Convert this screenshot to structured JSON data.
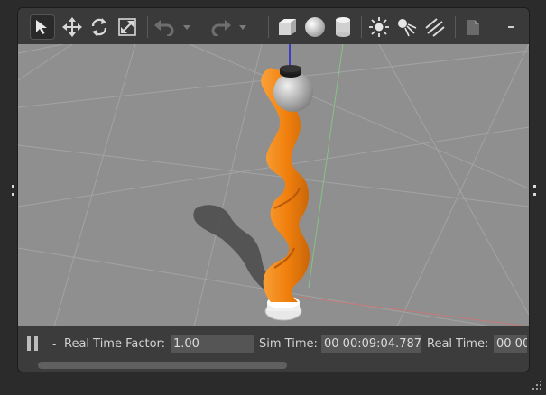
{
  "toolbar": {
    "tools": [
      {
        "name": "select-mode",
        "icon": "arrow-cursor-icon",
        "active": true
      },
      {
        "name": "translate-mode",
        "icon": "move-arrows-icon"
      },
      {
        "name": "rotate-mode",
        "icon": "rotate-icon"
      },
      {
        "name": "scale-mode",
        "icon": "scale-icon"
      },
      {
        "name": "undo",
        "icon": "undo-icon"
      },
      {
        "name": "undo-history",
        "icon": "chevron-down-icon"
      },
      {
        "name": "redo",
        "icon": "redo-icon"
      },
      {
        "name": "redo-history",
        "icon": "chevron-down-icon"
      },
      {
        "name": "insert-box",
        "icon": "box-icon"
      },
      {
        "name": "insert-sphere",
        "icon": "sphere-icon"
      },
      {
        "name": "insert-cylinder",
        "icon": "cylinder-icon"
      },
      {
        "name": "insert-point-light",
        "icon": "point-light-icon"
      },
      {
        "name": "insert-spot-light",
        "icon": "spot-light-icon"
      },
      {
        "name": "insert-directional-light",
        "icon": "directional-light-icon"
      },
      {
        "name": "copy",
        "icon": "copy-icon"
      },
      {
        "name": "more",
        "icon": "more-icon"
      }
    ]
  },
  "status": {
    "pause_icon": "pause-icon",
    "separator": "-",
    "real_time_factor_label": "Real Time Factor:",
    "real_time_factor_value": "1.00",
    "sim_time_label": "Sim Time:",
    "sim_time_value": "00 00:09:04.787",
    "real_time_label": "Real Time:",
    "real_time_value": "00 00"
  },
  "colors": {
    "ground": "#8f8f8f",
    "grid_line": "#a6a6a6",
    "robot_orange": "#f58412",
    "x_axis": "#c46a6a",
    "y_axis": "#7fbf7f",
    "z_axis": "#1f1fd0"
  }
}
